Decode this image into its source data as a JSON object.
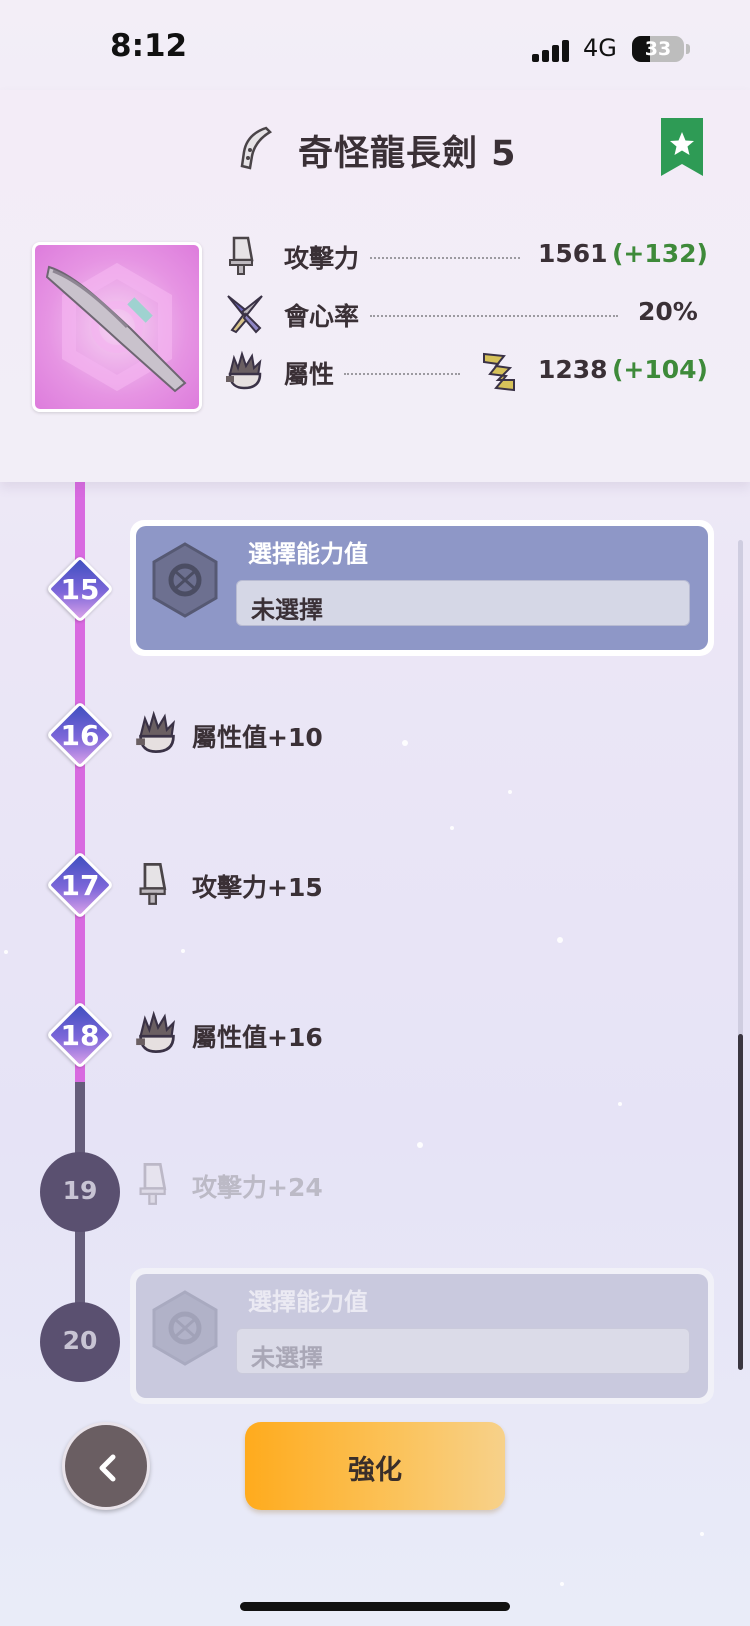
{
  "status_bar": {
    "time": "8:12",
    "network": "4G",
    "battery": "33"
  },
  "header": {
    "title": "奇怪龍長劍 5",
    "stats": [
      {
        "label": "攻擊力",
        "value": "1561",
        "bonus": "(+132)",
        "icon": "attack-blade-icon"
      },
      {
        "label": "會心率",
        "value": "20%",
        "bonus": "",
        "icon": "affinity-icon"
      },
      {
        "label": "屬性",
        "value": "1238",
        "bonus": "(+104)",
        "icon": "element-icon",
        "element_icon": "thunder-icon"
      }
    ]
  },
  "timeline": {
    "levels": [
      {
        "level": "15",
        "type": "choice",
        "title": "選擇能力值",
        "value": "未選擇",
        "unlocked": true
      },
      {
        "level": "16",
        "type": "perk",
        "label": "屬性值+10",
        "icon": "element-icon",
        "unlocked": true
      },
      {
        "level": "17",
        "type": "perk",
        "label": "攻擊力+15",
        "icon": "attack-blade-icon",
        "unlocked": true
      },
      {
        "level": "18",
        "type": "perk",
        "label": "屬性值+16",
        "icon": "element-icon",
        "unlocked": true
      },
      {
        "level": "19",
        "type": "perk",
        "label": "攻擊力+24",
        "icon": "attack-blade-icon",
        "unlocked": false
      },
      {
        "level": "20",
        "type": "choice",
        "title": "選擇能力值",
        "value": "未選擇",
        "unlocked": false
      }
    ]
  },
  "footer": {
    "enhance_label": "強化"
  },
  "colors": {
    "accent_green": "#2e9b55",
    "bonus_green": "#3e8a3a",
    "track_purple": "#d86ae0",
    "button_orange": "#ffab1d"
  }
}
